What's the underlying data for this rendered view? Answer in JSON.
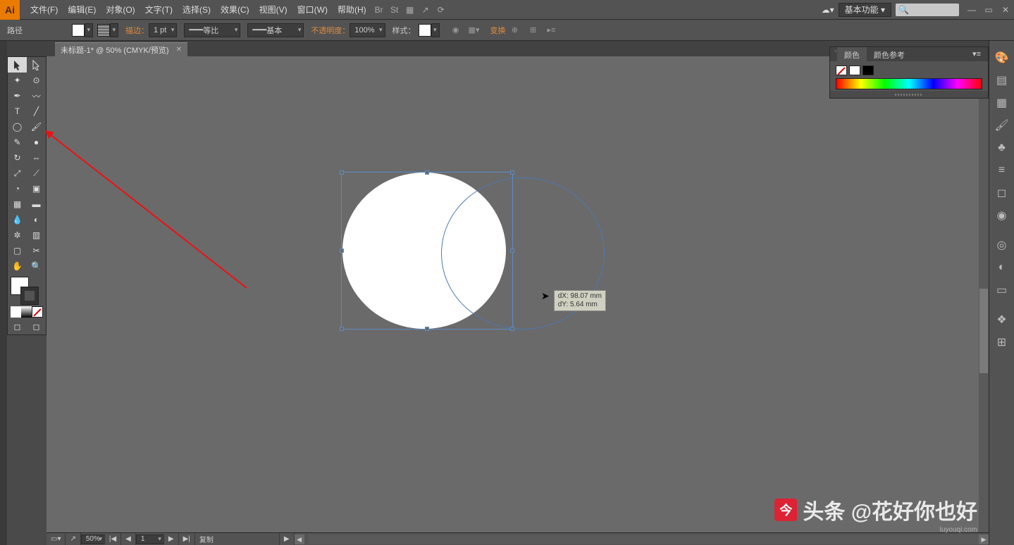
{
  "app": {
    "logo": "Ai"
  },
  "menu": {
    "items": [
      "文件(F)",
      "编辑(E)",
      "对象(O)",
      "文字(T)",
      "选择(S)",
      "效果(C)",
      "视图(V)",
      "窗口(W)",
      "帮助(H)"
    ],
    "workspace_label": "基本功能",
    "search_placeholder": ""
  },
  "options": {
    "selection_label": "路径",
    "stroke_label": "描边：",
    "stroke_weight": "1 pt",
    "brush_profile": "等比",
    "brush_def": "基本",
    "opacity_label": "不透明度：",
    "opacity_value": "100%",
    "style_label": "样式：",
    "transform_label": "变换"
  },
  "document": {
    "tab_title": "未标题-1* @ 50% (CMYK/预览)"
  },
  "color_panel": {
    "tab_color": "颜色",
    "tab_guide": "颜色参考"
  },
  "measure": {
    "dx_label": "dX:",
    "dx_value": "98.07 mm",
    "dy_label": "dY:",
    "dy_value": "5.64 mm"
  },
  "status": {
    "zoom": "50%",
    "page_nav": "1",
    "action": "复制"
  },
  "watermark": {
    "prefix": "头条",
    "text": "@花好你也好",
    "sub": "luyouqi.com"
  }
}
